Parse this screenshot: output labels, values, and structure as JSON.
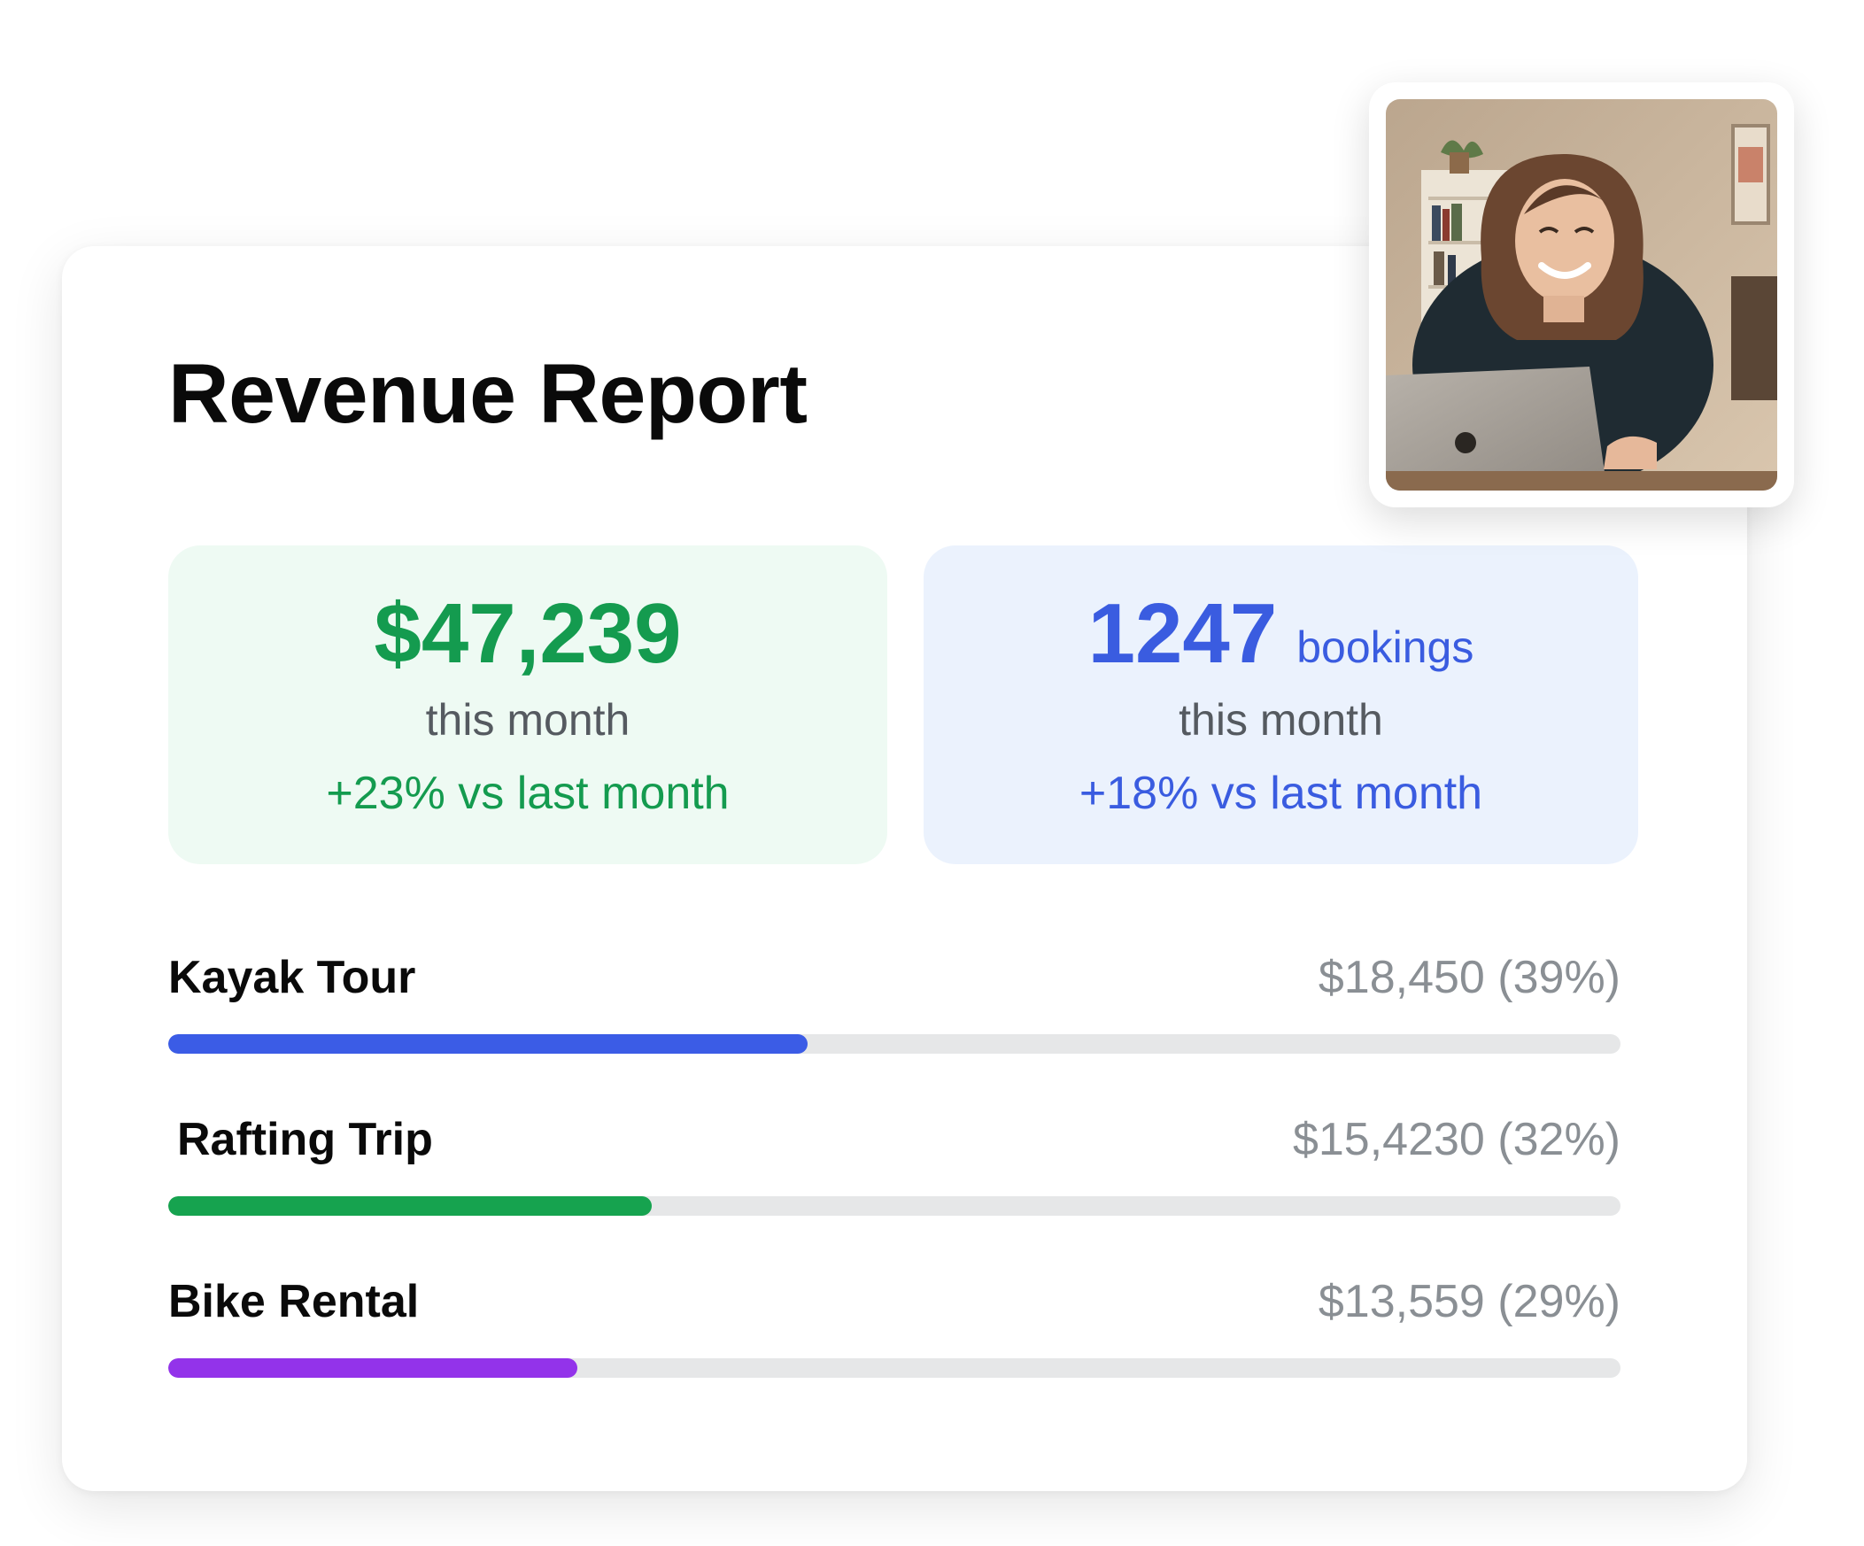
{
  "report": {
    "title": "Revenue Report"
  },
  "revenue_card": {
    "value": "$47,239",
    "period": "this month",
    "change": "+23% vs last month",
    "accent_color": "#149b4f",
    "background_color": "#eefaf3"
  },
  "bookings_card": {
    "value": "1247",
    "unit": "bookings",
    "period": "this month",
    "change": "+18% vs last month",
    "accent_color": "#3a5ce0",
    "background_color": "#ebf2fd"
  },
  "breakdown": [
    {
      "name": "Kayak Tour",
      "amount_label": "$18,450 (39%)",
      "fill_fraction": 0.44,
      "color": "#3b5ce6"
    },
    {
      "name": "Rafting Trip",
      "amount_label": "$15,4230 (32%)",
      "fill_fraction": 0.333,
      "color": "#16a34f"
    },
    {
      "name": "Bike Rental",
      "amount_label": "$13,559 (29%)",
      "fill_fraction": 0.282,
      "color": "#9333ea"
    }
  ],
  "profile_photo": {
    "icon": "person-photo"
  }
}
